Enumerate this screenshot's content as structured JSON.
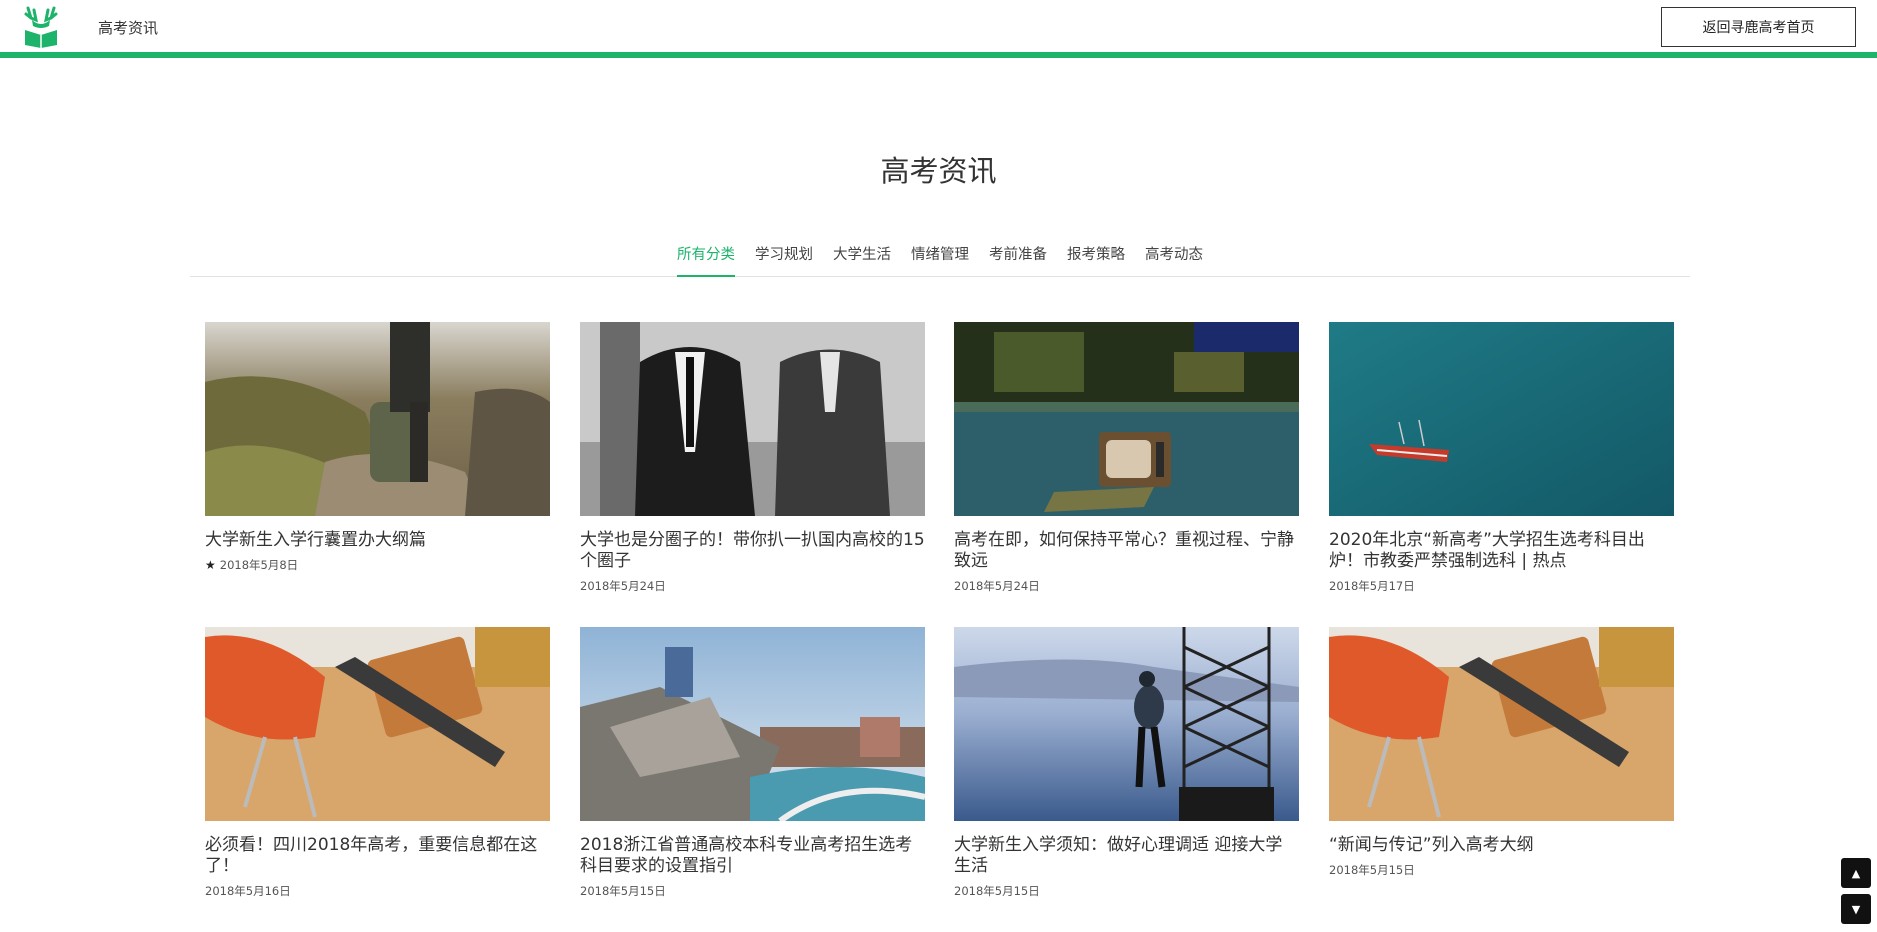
{
  "header": {
    "site_title": "高考资讯",
    "home_button": "返回寻鹿高考首页",
    "accent_color": "#1db36b",
    "logo_icon": "deer-book-icon"
  },
  "page": {
    "title": "高考资讯"
  },
  "tabs": [
    {
      "label": "所有分类",
      "active": true
    },
    {
      "label": "学习规划",
      "active": false
    },
    {
      "label": "大学生活",
      "active": false
    },
    {
      "label": "情绪管理",
      "active": false
    },
    {
      "label": "考前准备",
      "active": false
    },
    {
      "label": "报考策略",
      "active": false
    },
    {
      "label": "高考动态",
      "active": false
    }
  ],
  "articles": [
    {
      "title": "大学新生入学行囊置办大纲篇",
      "date": "2018年5月8日",
      "starred": true,
      "image": "hiker-backpack-photo"
    },
    {
      "title": "大学也是分圈子的！带你扒一扒国内高校的15个圈子",
      "date": "2018年5月24日",
      "starred": false,
      "image": "business-people-photo"
    },
    {
      "title": "高考在即，如何保持平常心？重视过程、宁静致远",
      "date": "2018年5月24日",
      "starred": false,
      "image": "tv-on-street-photo"
    },
    {
      "title": "2020年北京“新高考”大学招生选考科目出炉！市教委严禁强制选科 | 热点",
      "date": "2018年5月17日",
      "starred": false,
      "image": "boat-on-water-photo"
    },
    {
      "title": "必须看！四川2018年高考，重要信息都在这了！",
      "date": "2018年5月16日",
      "starred": false,
      "image": "desk-chair-photo"
    },
    {
      "title": "2018浙江省普通高校本科专业高考招生选考科目要求的设置指引",
      "date": "2018年5月15日",
      "starred": false,
      "image": "city-river-photo"
    },
    {
      "title": "大学新生入学须知：做好心理调适 迎接大学生活",
      "date": "2018年5月15日",
      "starred": false,
      "image": "climber-tower-photo"
    },
    {
      "title": "“新闻与传记”列入高考大纲",
      "date": "2018年5月15日",
      "starred": false,
      "image": "desk-chair-photo"
    }
  ],
  "scroll": {
    "up_icon": "arrow-up-icon",
    "down_icon": "arrow-down-icon"
  }
}
